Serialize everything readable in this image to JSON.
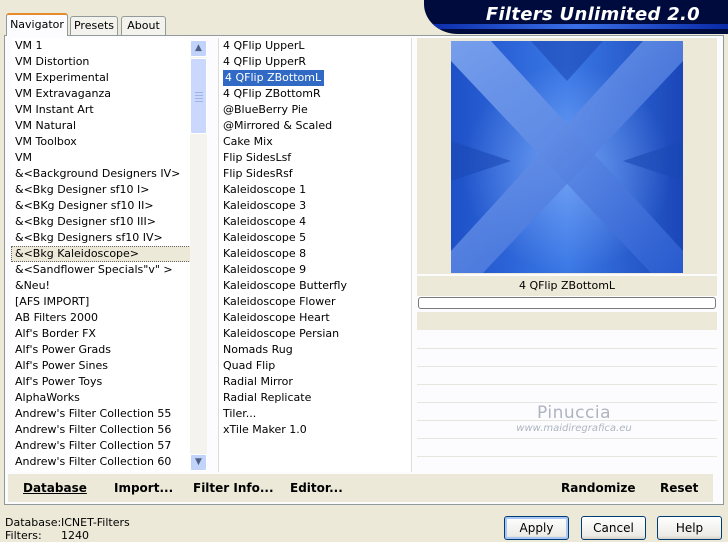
{
  "tabs": [
    {
      "label": "Navigator",
      "active": true
    },
    {
      "label": "Presets",
      "active": false
    },
    {
      "label": "About",
      "active": false
    }
  ],
  "banner_title": "Filters Unlimited 2.0",
  "categories": {
    "items": [
      "VM 1",
      "VM Distortion",
      "VM Experimental",
      "VM Extravaganza",
      "VM Instant Art",
      "VM Natural",
      "VM Toolbox",
      "VM",
      "&<Background Designers IV>",
      "&<Bkg Designer sf10 I>",
      "&<BKg Designer sf10 II>",
      "&<Bkg Designer sf10 III>",
      "&<Bkg Designers sf10 IV>",
      "&<Bkg Kaleidoscope>",
      "&<Sandflower Specials\"v\" >",
      "&Neu!",
      "[AFS IMPORT]",
      "AB Filters 2000",
      "Alf's Border FX",
      "Alf's Power Grads",
      "Alf's Power Sines",
      "Alf's Power Toys",
      "AlphaWorks",
      "Andrew's Filter Collection 55",
      "Andrew's Filter Collection 56",
      "Andrew's Filter Collection 57",
      "Andrew's Filter Collection 60"
    ],
    "selected": "&<Bkg Kaleidoscope>"
  },
  "filters": {
    "items": [
      "4 QFlip UpperL",
      "4 QFlip UpperR",
      "4 QFlip ZBottomL",
      "4 QFlip ZBottomR",
      "@BlueBerry Pie",
      "@Mirrored & Scaled",
      "Cake Mix",
      "Flip SidesLsf",
      "Flip SidesRsf",
      "Kaleidoscope 1",
      "Kaleidoscope 3",
      "Kaleidoscope 4",
      "Kaleidoscope 5",
      "Kaleidoscope 8",
      "Kaleidoscope 9",
      "Kaleidoscope Butterfly",
      "Kaleidoscope Flower",
      "Kaleidoscope Heart",
      "Kaleidoscope Persian",
      "Nomads Rug",
      "Quad Flip",
      "Radial Mirror",
      "Radial Replicate",
      "Tiler...",
      "xTile Maker 1.0"
    ],
    "selected": "4 QFlip ZBottomL"
  },
  "preview": {
    "filter_name": "4 QFlip ZBottomL",
    "progress": 0
  },
  "watermark": {
    "name": "Pinuccia",
    "url": "www.maidiregrafica.eu"
  },
  "bottom_bar": {
    "database": "Database",
    "import": "Import...",
    "filter_info": "Filter Info...",
    "editor": "Editor...",
    "randomize": "Randomize",
    "reset": "Reset"
  },
  "status": {
    "database_label": "Database:",
    "database_value": "ICNET-Filters",
    "filters_label": "Filters:",
    "filters_value": "1240"
  },
  "buttons": {
    "apply": "Apply",
    "cancel": "Cancel",
    "help": "Help"
  },
  "colors": {
    "selection": "#316ac5",
    "banner": "#000b3d",
    "tab_accent": "#e68b2c"
  }
}
